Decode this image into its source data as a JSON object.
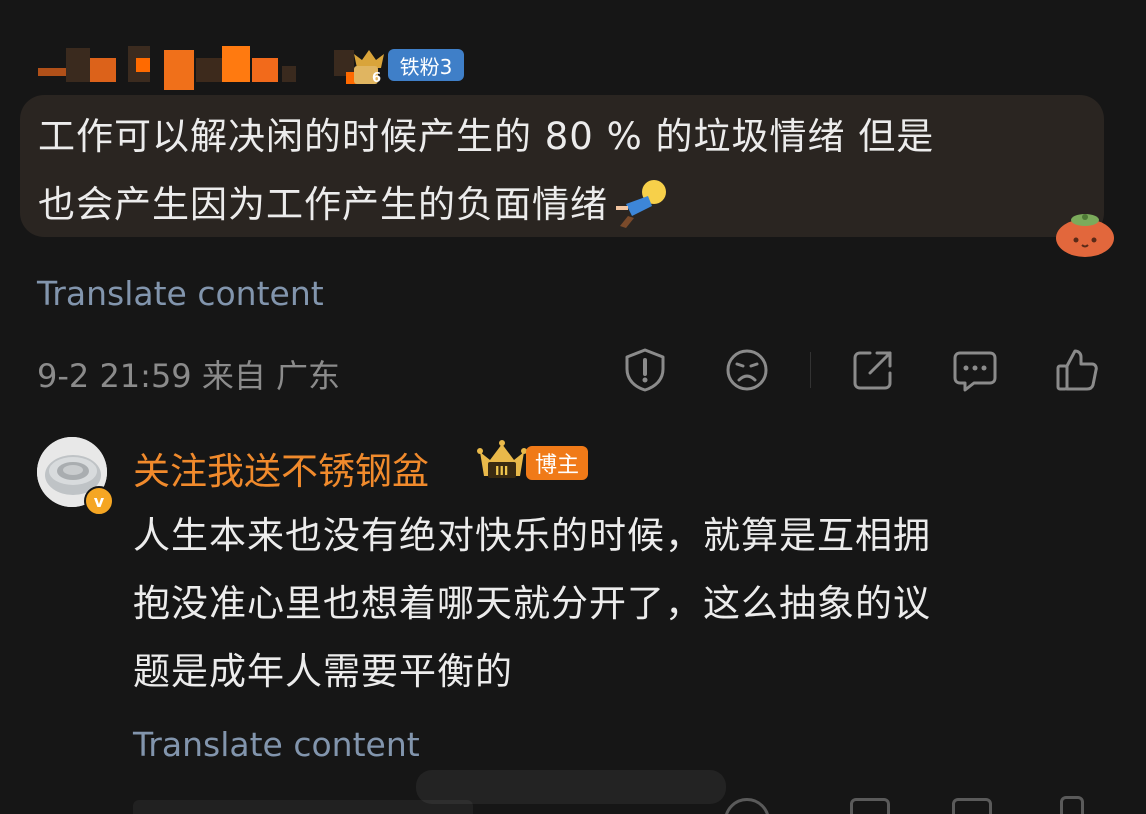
{
  "comment1": {
    "fan_badge": "铁粉3",
    "text_line1": "工作可以解决闲的时候产生的 80 % 的垃圾情绪 但是",
    "text_line2": "也会产生因为工作产生的负面情绪",
    "translate": "Translate content",
    "meta": "9-2 21:59 来自 广东"
  },
  "comment2": {
    "username": "关注我送不锈钢盆",
    "blogger_badge": "博主",
    "text_line1": "人生本来也没有绝对快乐的时候，就算是互相拥",
    "text_line2": "抱没准心里也想着哪天就分开了，这么抽象的议",
    "text_line3": "题是成年人需要平衡的",
    "translate": "Translate content"
  },
  "icons": [
    "report-icon",
    "dislike-icon",
    "share-icon",
    "comment-icon",
    "like-icon"
  ],
  "colors": {
    "background": "#161616",
    "bubble": "#2a2521",
    "translate_link": "#8295ad",
    "username_orange": "#f08a2c",
    "fan_badge": "#3f7fc8"
  }
}
